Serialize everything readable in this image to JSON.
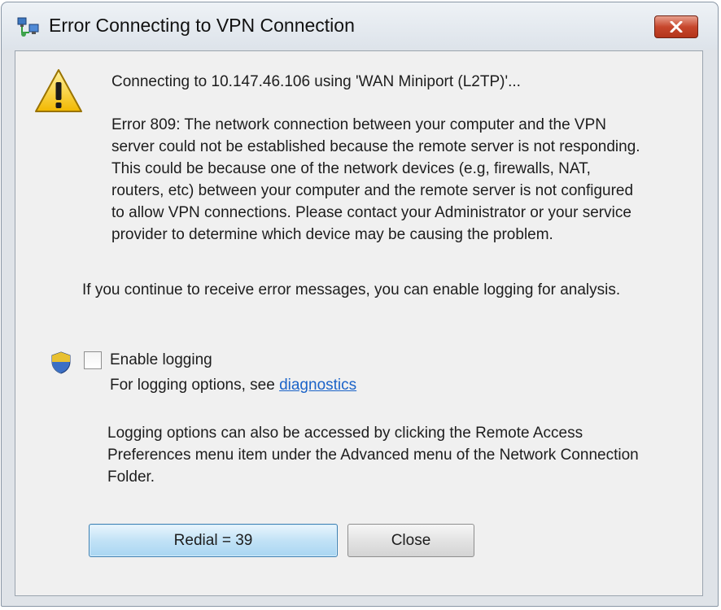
{
  "window": {
    "title": "Error Connecting to VPN Connection"
  },
  "message": {
    "connecting": "Connecting to 10.147.46.106 using 'WAN Miniport (L2TP)'...",
    "error_text": "Error 809: The network connection between your computer and the VPN server could not be established because the remote server is not responding. This could be because one of the network devices (e.g, firewalls, NAT, routers, etc) between your computer and the remote server is not configured to allow VPN connections. Please contact your Administrator or your service provider to determine which device may be causing the problem.",
    "info": "If you continue to receive error messages, you can enable logging for analysis."
  },
  "logging": {
    "checkbox_label": "Enable logging",
    "checked": false,
    "options_prefix": "For logging options, see ",
    "link_text": "diagnostics",
    "note": "Logging options can also be accessed by clicking the Remote Access Preferences menu item under the Advanced menu of the Network Connection Folder."
  },
  "buttons": {
    "redial": "Redial = 39",
    "close": "Close"
  },
  "icons": {
    "app": "network-connection-icon",
    "warning": "warning-icon",
    "shield": "uac-shield-icon",
    "close": "close-icon"
  },
  "colors": {
    "link": "#1b63c8",
    "close_button": "#c7472d",
    "default_button_border": "#3c7fb1"
  }
}
